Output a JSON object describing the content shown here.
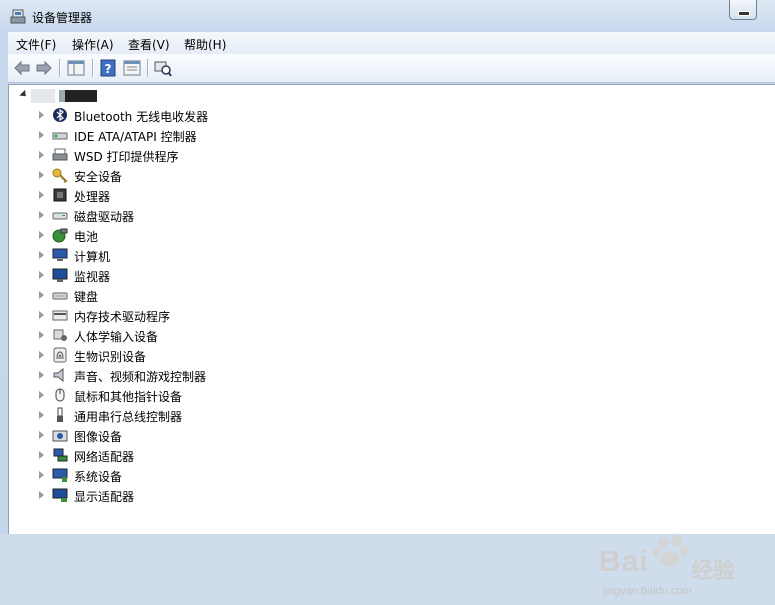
{
  "window": {
    "title": "设备管理器"
  },
  "menu": [
    "文件(F)",
    "操作(A)",
    "查看(V)",
    "帮助(H)"
  ],
  "toolbar": [
    "back-arrow-icon",
    "forward-arrow-icon",
    "show-hide-tree-icon",
    "help-icon",
    "properties-icon",
    "scan-hardware-icon"
  ],
  "tree": {
    "devices": [
      {
        "label": "Bluetooth 无线电收发器",
        "icon": "bluetooth-icon"
      },
      {
        "label": "IDE ATA/ATAPI 控制器",
        "icon": "ide-controller-icon"
      },
      {
        "label": "WSD 打印提供程序",
        "icon": "printer-icon"
      },
      {
        "label": "安全设备",
        "icon": "key-icon"
      },
      {
        "label": "处理器",
        "icon": "processor-icon"
      },
      {
        "label": "磁盘驱动器",
        "icon": "disk-drive-icon"
      },
      {
        "label": "电池",
        "icon": "battery-icon"
      },
      {
        "label": "计算机",
        "icon": "computer-icon"
      },
      {
        "label": "监视器",
        "icon": "monitor-icon"
      },
      {
        "label": "键盘",
        "icon": "keyboard-icon"
      },
      {
        "label": "内存技术驱动程序",
        "icon": "memory-icon"
      },
      {
        "label": "人体学输入设备",
        "icon": "hid-icon"
      },
      {
        "label": "生物识别设备",
        "icon": "fingerprint-icon"
      },
      {
        "label": "声音、视频和游戏控制器",
        "icon": "speaker-icon"
      },
      {
        "label": "鼠标和其他指针设备",
        "icon": "mouse-icon"
      },
      {
        "label": "通用串行总线控制器",
        "icon": "usb-icon"
      },
      {
        "label": "图像设备",
        "icon": "camera-icon"
      },
      {
        "label": "网络适配器",
        "icon": "network-icon"
      },
      {
        "label": "系统设备",
        "icon": "system-icon"
      },
      {
        "label": "显示适配器",
        "icon": "display-adapter-icon"
      }
    ]
  },
  "watermark": {
    "brand": "Bai",
    "brand2": "经验",
    "url": "jingyan.baidu.com"
  }
}
